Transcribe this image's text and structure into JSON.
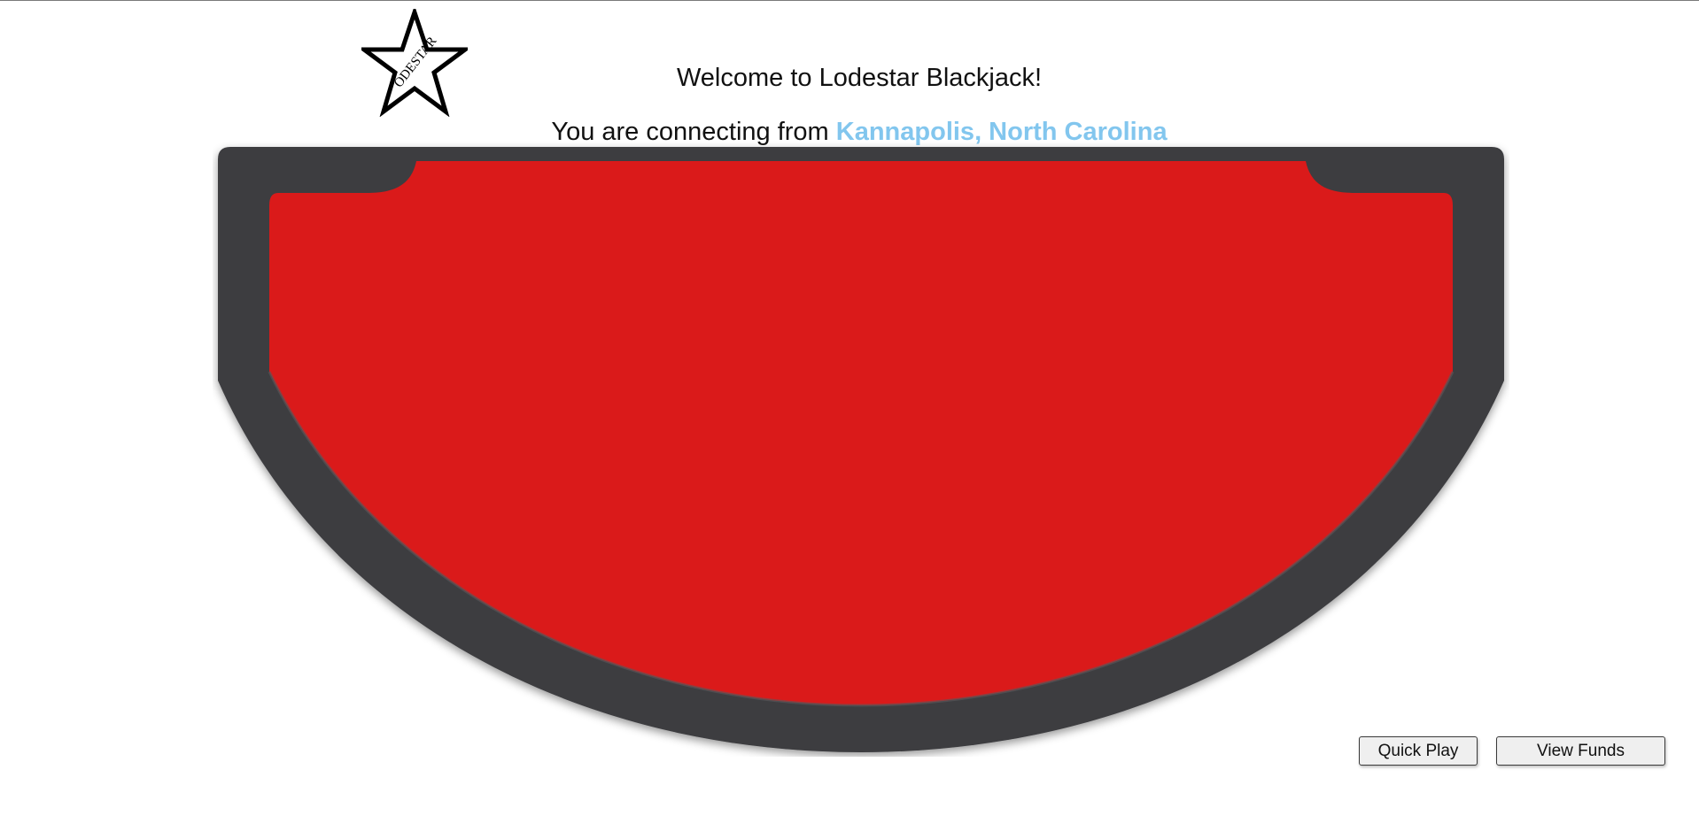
{
  "header": {
    "welcome_text": "Welcome to Lodestar Blackjack!",
    "connecting_prefix": "You are connecting from ",
    "location": "Kannapolis, North Carolina",
    "location_color": "#82c6ee"
  },
  "logo": {
    "text": "ODESTAR",
    "icon": "star-logo-icon"
  },
  "table": {
    "felt_color": "#da1a1a",
    "rail_color": "#3d3d40"
  },
  "actions": {
    "quick_play_label": "Quick Play",
    "view_funds_label": "View Funds"
  }
}
